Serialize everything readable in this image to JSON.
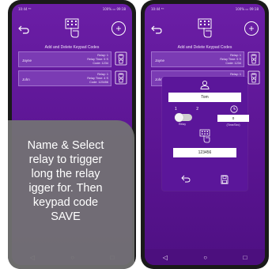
{
  "status": {
    "left": "10:44 ⁵ᴳ",
    "right": "100% ▭ 09:18"
  },
  "header": {
    "title": "Add and Delete Keypad Codes"
  },
  "codes": [
    {
      "name": "Jayne",
      "relay": "Relay: 1",
      "relay_time": "Relay Time: 5 S",
      "code": "Code: 1234"
    },
    {
      "name": "John",
      "relay": "Relay: 1",
      "relay_time": "Relay Time: 4 S",
      "code": "Code: 123456"
    }
  ],
  "modal": {
    "name_value": "Tom",
    "relay_options": [
      "1",
      "2"
    ],
    "relay_label": "Relay",
    "time_value": "0",
    "time_unit": "(Time/Sec)",
    "code_value": "123456"
  },
  "tooltip": {
    "lines": [
      "Name & Select",
      "relay to trigger",
      "long the relay",
      "igger for. Then",
      "keypad code",
      "SAVE"
    ]
  }
}
